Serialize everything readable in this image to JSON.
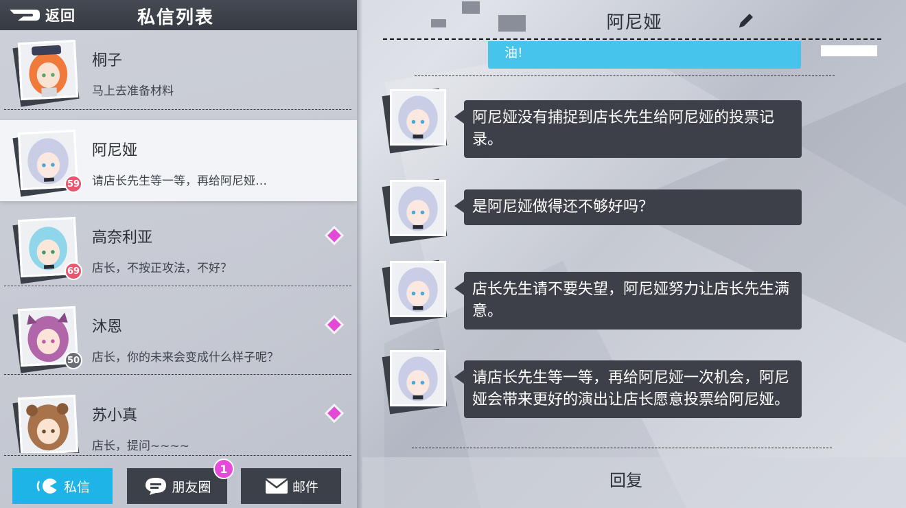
{
  "header": {
    "back_label": "返回",
    "title": "私信列表"
  },
  "contacts": [
    {
      "name": "桐子",
      "preview": "马上去准备材料",
      "level": "",
      "hair": "#f07a3a",
      "skin": "#fbe3d4",
      "eye": "#5aa86a",
      "badge_color": "",
      "diamond": false
    },
    {
      "name": "阿尼娅",
      "preview": "请店长先生等一等，再给阿尼娅…",
      "level": "59",
      "hair": "#c9cde6",
      "skin": "#fbe8e0",
      "eye": "#4aa8d8",
      "badge_color": "#e9566f",
      "diamond": false
    },
    {
      "name": "高奈利亚",
      "preview": "店长，不按正攻法，不好？",
      "level": "69",
      "hair": "#8fd6ea",
      "skin": "#fbe6da",
      "eye": "#3d9a6a",
      "badge_color": "#e9566f",
      "diamond": true
    },
    {
      "name": "沐恩",
      "preview": "店长，你的未来会变成什么样子呢？",
      "level": "50",
      "hair": "#b066a8",
      "skin": "#fbe3d9",
      "eye": "#c05aa8",
      "badge_color": "#6a6e76",
      "diamond": true
    },
    {
      "name": "苏小真",
      "preview": "店长，提问~~~~",
      "level": "",
      "hair": "#a8724a",
      "skin": "#fbe3d2",
      "eye": "#6a4a2a",
      "badge_color": "",
      "diamond": true
    }
  ],
  "tabs": [
    {
      "label": "私信",
      "icon": "chat-bubble-icon",
      "active": true,
      "badge": ""
    },
    {
      "label": "朋友圈",
      "icon": "moments-icon",
      "active": false,
      "badge": "1"
    },
    {
      "label": "邮件",
      "icon": "mail-icon",
      "active": false,
      "badge": ""
    }
  ],
  "chat": {
    "title": "阿尼娅",
    "partial_top_text": "油!",
    "messages": [
      {
        "text": "阿尼娅没有捕捉到店长先生给阿尼娅的投票记录。"
      },
      {
        "text": "是阿尼娅做得还不够好吗？"
      },
      {
        "text": "店长先生请不要失望，阿尼娅努力让店长先生满意。"
      },
      {
        "text": "请店长先生等一等，再给阿尼娅一次机会，阿尼娅会带来更好的演出让店长愿意投票给阿尼娅。"
      }
    ],
    "reply_label": "回复"
  },
  "colors": {
    "accent": "#1fb4e8",
    "bubble": "#3d4048",
    "diamond": "#e34bd7",
    "notification": "#e64ad9"
  }
}
